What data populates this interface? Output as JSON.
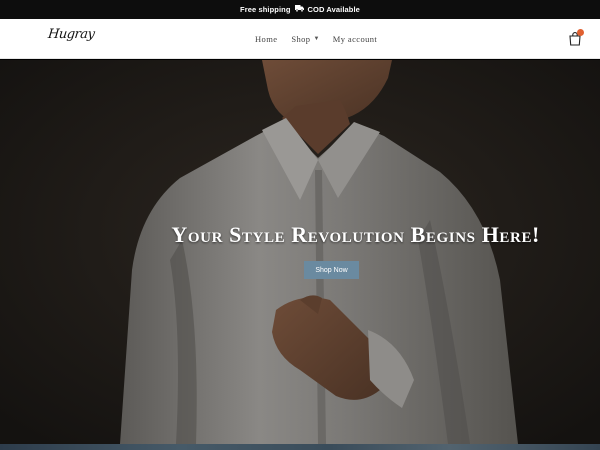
{
  "topbar": {
    "shipping_text": "Free shipping",
    "cod_text": "COD Available",
    "truck_icon": "truck-icon"
  },
  "header": {
    "logo_text": "Hugray",
    "nav": {
      "home": "Home",
      "shop": "Shop",
      "account": "My account"
    },
    "cart_icon": "cart-icon"
  },
  "hero": {
    "title": "Your Style Revolution Begins Here!",
    "cta_label": "Shop Now",
    "cta_color": "#6a8aa0"
  }
}
